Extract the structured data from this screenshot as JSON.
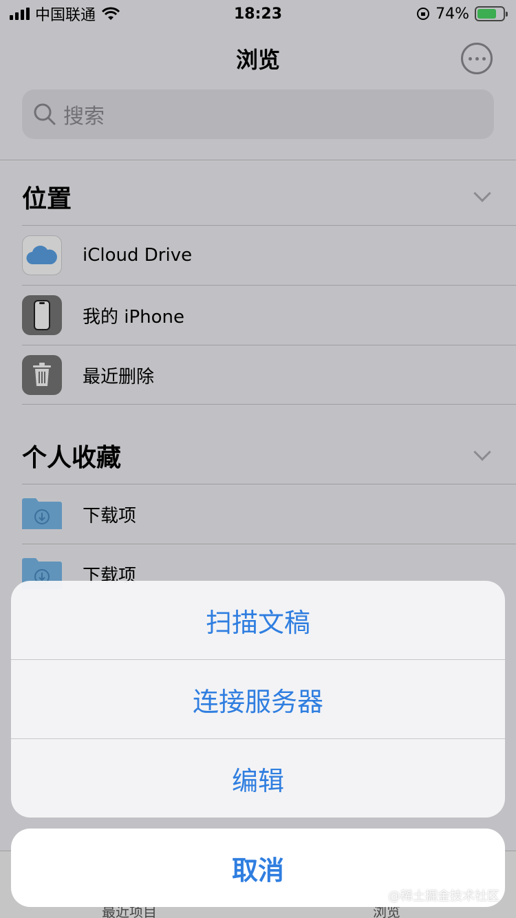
{
  "status_bar": {
    "carrier": "中国联通",
    "time": "18:23",
    "battery": "74%",
    "battery_level": 0.74
  },
  "nav": {
    "title": "浏览"
  },
  "search": {
    "placeholder": "搜索"
  },
  "sections": {
    "locations": {
      "title": "位置",
      "items": [
        {
          "label": "iCloud Drive",
          "icon": "icloud-icon"
        },
        {
          "label": "我的 iPhone",
          "icon": "iphone-icon"
        },
        {
          "label": "最近删除",
          "icon": "trash-icon"
        }
      ]
    },
    "favorites": {
      "title": "个人收藏",
      "items": [
        {
          "label": "下载项",
          "icon": "downloads-folder-icon"
        },
        {
          "label": "下载项",
          "icon": "downloads-folder-icon"
        }
      ]
    }
  },
  "tab_bar": {
    "recents": "最近项目",
    "browse": "浏览"
  },
  "action_sheet": {
    "scan_documents": "扫描文稿",
    "connect_server": "连接服务器",
    "edit": "编辑",
    "cancel": "取消"
  },
  "watermark": "@稀土掘金技术社区",
  "colors": {
    "accent": "#2f7ee0",
    "battery_green": "#4cd964"
  }
}
